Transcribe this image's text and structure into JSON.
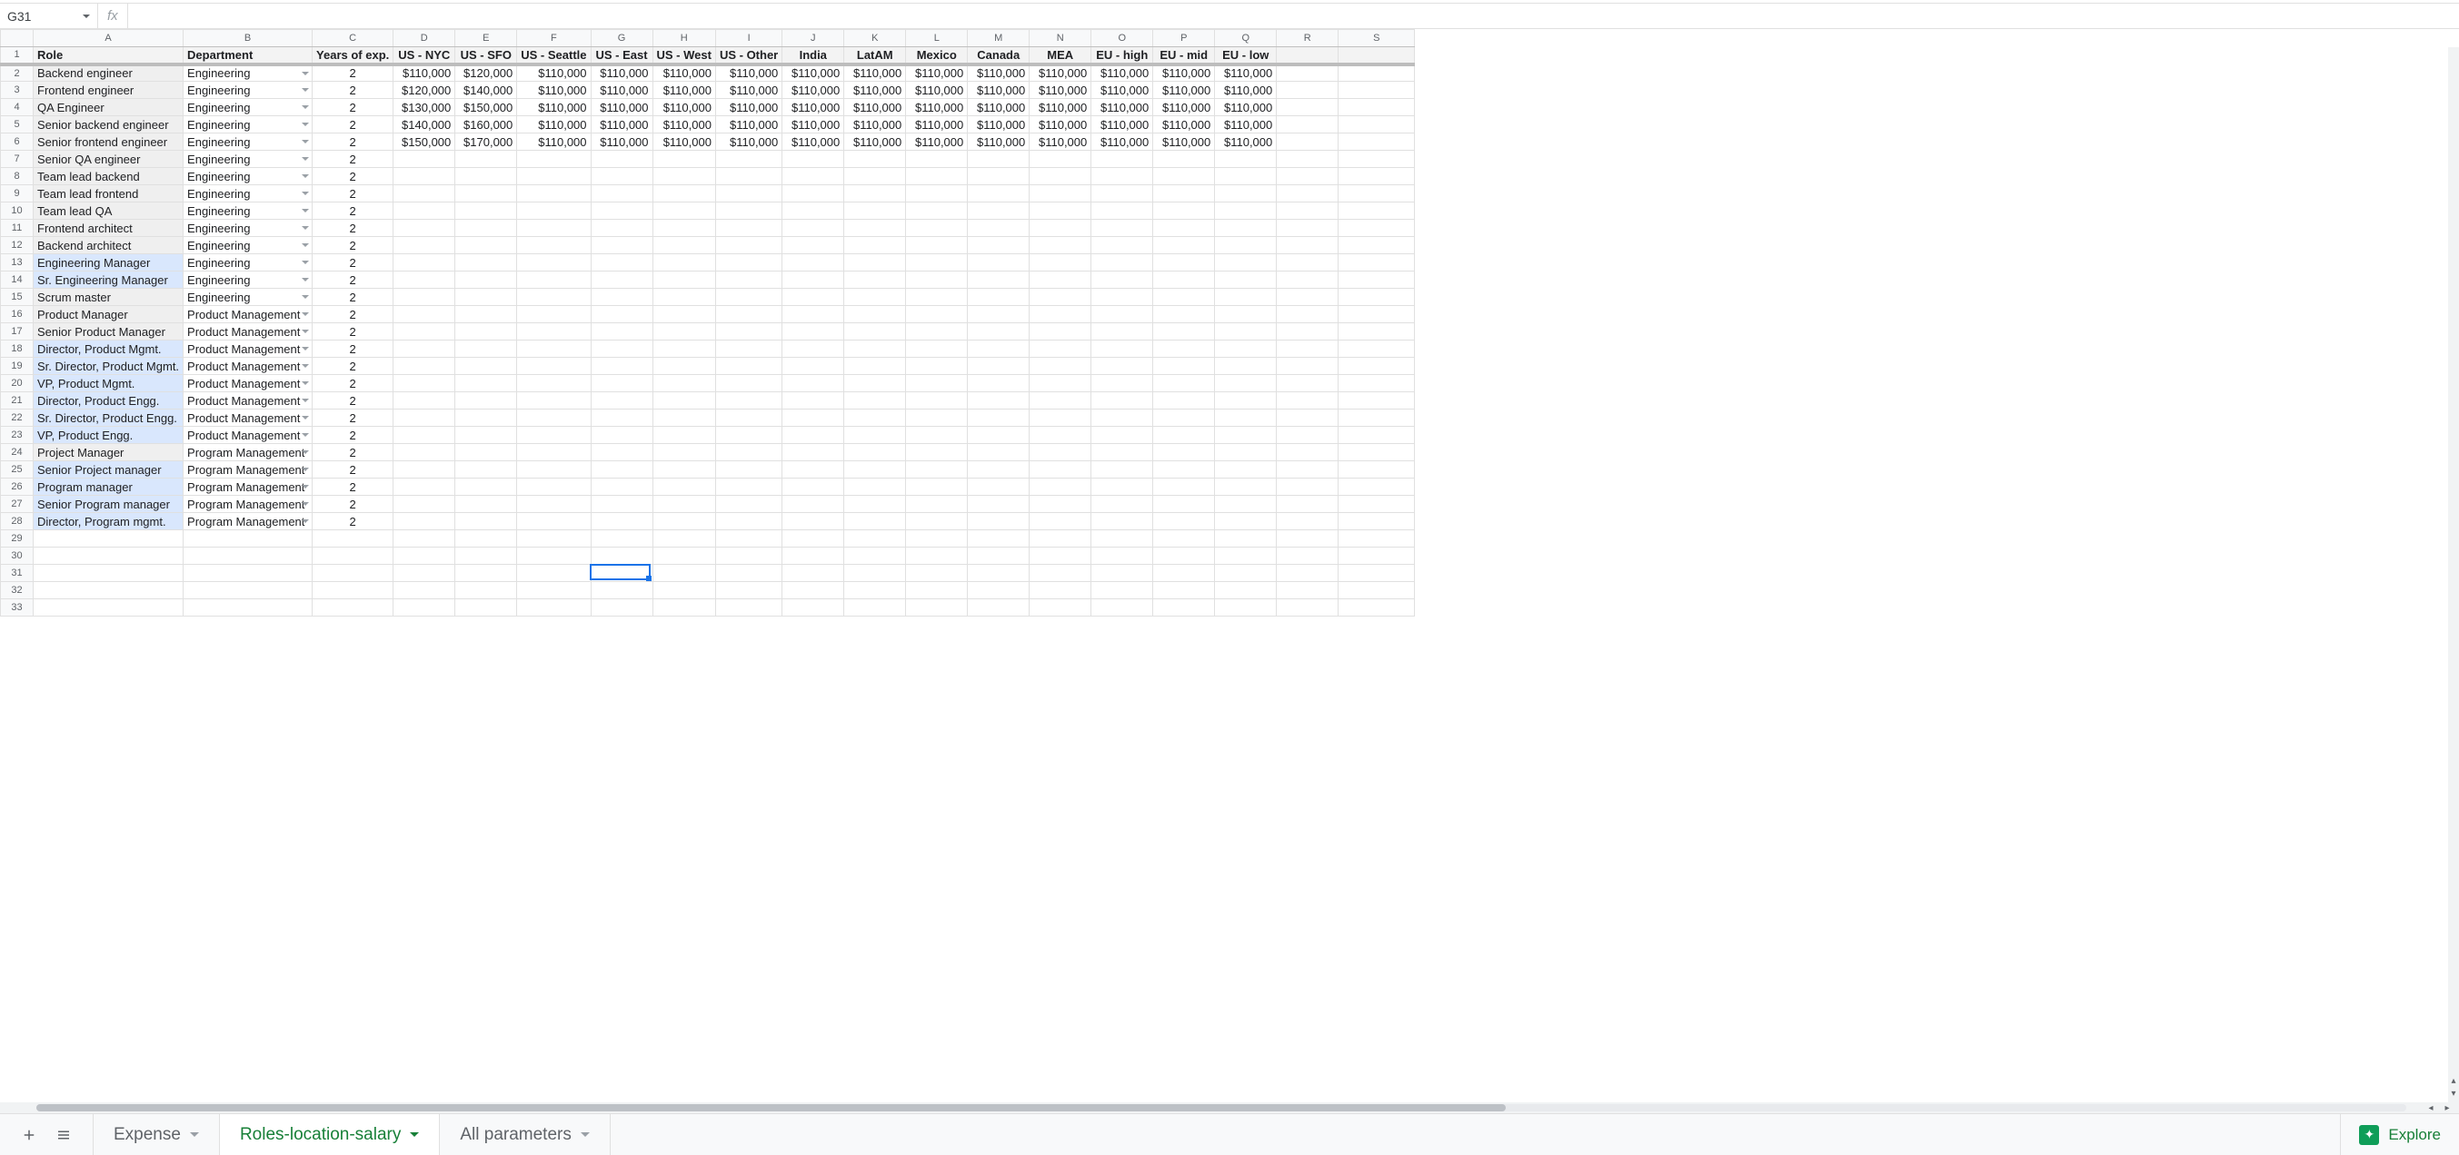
{
  "name_box": "G31",
  "fx_label": "fx",
  "formula_value": "",
  "columns": [
    {
      "letter": "A",
      "width": 160
    },
    {
      "letter": "B",
      "width": 142
    },
    {
      "letter": "C",
      "width": 78
    },
    {
      "letter": "D",
      "width": 68
    },
    {
      "letter": "E",
      "width": 68
    },
    {
      "letter": "F",
      "width": 68
    },
    {
      "letter": "G",
      "width": 68
    },
    {
      "letter": "H",
      "width": 68
    },
    {
      "letter": "I",
      "width": 68
    },
    {
      "letter": "J",
      "width": 68
    },
    {
      "letter": "K",
      "width": 68
    },
    {
      "letter": "L",
      "width": 68
    },
    {
      "letter": "M",
      "width": 68
    },
    {
      "letter": "N",
      "width": 68
    },
    {
      "letter": "O",
      "width": 68
    },
    {
      "letter": "P",
      "width": 68
    },
    {
      "letter": "Q",
      "width": 68
    },
    {
      "letter": "R",
      "width": 68
    },
    {
      "letter": "S",
      "width": 84
    }
  ],
  "header_row": [
    "Role",
    "Department",
    "Years of exp.",
    "US - NYC",
    "US - SFO",
    "US - Seattle",
    "US - East",
    "US - West",
    "US - Other",
    "India",
    "LatAM",
    "Mexico",
    "Canada",
    "MEA",
    "EU - high",
    "EU - mid",
    "EU - low",
    "",
    ""
  ],
  "rows": [
    {
      "n": 2,
      "role": "Backend engineer",
      "mgr": false,
      "dept": "Engineering",
      "yrs": "2",
      "sal": [
        "$110,000",
        "$120,000",
        "$110,000",
        "$110,000",
        "$110,000",
        "$110,000",
        "$110,000",
        "$110,000",
        "$110,000",
        "$110,000",
        "$110,000",
        "$110,000",
        "$110,000",
        "$110,000"
      ]
    },
    {
      "n": 3,
      "role": "Frontend engineer",
      "mgr": false,
      "dept": "Engineering",
      "yrs": "2",
      "sal": [
        "$120,000",
        "$140,000",
        "$110,000",
        "$110,000",
        "$110,000",
        "$110,000",
        "$110,000",
        "$110,000",
        "$110,000",
        "$110,000",
        "$110,000",
        "$110,000",
        "$110,000",
        "$110,000"
      ]
    },
    {
      "n": 4,
      "role": "QA Engineer",
      "mgr": false,
      "dept": "Engineering",
      "yrs": "2",
      "sal": [
        "$130,000",
        "$150,000",
        "$110,000",
        "$110,000",
        "$110,000",
        "$110,000",
        "$110,000",
        "$110,000",
        "$110,000",
        "$110,000",
        "$110,000",
        "$110,000",
        "$110,000",
        "$110,000"
      ]
    },
    {
      "n": 5,
      "role": "Senior backend engineer",
      "mgr": false,
      "dept": "Engineering",
      "yrs": "2",
      "sal": [
        "$140,000",
        "$160,000",
        "$110,000",
        "$110,000",
        "$110,000",
        "$110,000",
        "$110,000",
        "$110,000",
        "$110,000",
        "$110,000",
        "$110,000",
        "$110,000",
        "$110,000",
        "$110,000"
      ]
    },
    {
      "n": 6,
      "role": "Senior frontend engineer",
      "mgr": false,
      "dept": "Engineering",
      "yrs": "2",
      "sal": [
        "$150,000",
        "$170,000",
        "$110,000",
        "$110,000",
        "$110,000",
        "$110,000",
        "$110,000",
        "$110,000",
        "$110,000",
        "$110,000",
        "$110,000",
        "$110,000",
        "$110,000",
        "$110,000"
      ]
    },
    {
      "n": 7,
      "role": "Senior QA engineer",
      "mgr": false,
      "dept": "Engineering",
      "yrs": "2",
      "sal": []
    },
    {
      "n": 8,
      "role": "Team lead backend",
      "mgr": false,
      "dept": "Engineering",
      "yrs": "2",
      "sal": []
    },
    {
      "n": 9,
      "role": "Team lead frontend",
      "mgr": false,
      "dept": "Engineering",
      "yrs": "2",
      "sal": []
    },
    {
      "n": 10,
      "role": "Team lead QA",
      "mgr": false,
      "dept": "Engineering",
      "yrs": "2",
      "sal": []
    },
    {
      "n": 11,
      "role": "Frontend architect",
      "mgr": false,
      "dept": "Engineering",
      "yrs": "2",
      "sal": []
    },
    {
      "n": 12,
      "role": "Backend architect",
      "mgr": false,
      "dept": "Engineering",
      "yrs": "2",
      "sal": []
    },
    {
      "n": 13,
      "role": "Engineering Manager",
      "mgr": true,
      "dept": "Engineering",
      "yrs": "2",
      "sal": []
    },
    {
      "n": 14,
      "role": "Sr. Engineering Manager",
      "mgr": true,
      "dept": "Engineering",
      "yrs": "2",
      "sal": []
    },
    {
      "n": 15,
      "role": "Scrum master",
      "mgr": false,
      "dept": "Engineering",
      "yrs": "2",
      "sal": []
    },
    {
      "n": 16,
      "role": "Product Manager",
      "mgr": false,
      "dept": "Product Management",
      "yrs": "2",
      "sal": []
    },
    {
      "n": 17,
      "role": "Senior Product Manager",
      "mgr": false,
      "dept": "Product Management",
      "yrs": "2",
      "sal": []
    },
    {
      "n": 18,
      "role": "Director, Product Mgmt.",
      "mgr": true,
      "dept": "Product Management",
      "yrs": "2",
      "sal": []
    },
    {
      "n": 19,
      "role": "Sr. Director, Product Mgmt.",
      "mgr": true,
      "dept": "Product Management",
      "yrs": "2",
      "sal": []
    },
    {
      "n": 20,
      "role": "VP, Product Mgmt.",
      "mgr": true,
      "dept": "Product Management",
      "yrs": "2",
      "sal": []
    },
    {
      "n": 21,
      "role": "Director, Product Engg.",
      "mgr": true,
      "dept": "Product Management",
      "yrs": "2",
      "sal": []
    },
    {
      "n": 22,
      "role": "Sr. Director, Product Engg.",
      "mgr": true,
      "dept": "Product Management",
      "yrs": "2",
      "sal": []
    },
    {
      "n": 23,
      "role": "VP, Product Engg.",
      "mgr": true,
      "dept": "Product Management",
      "yrs": "2",
      "sal": []
    },
    {
      "n": 24,
      "role": "Project Manager",
      "mgr": false,
      "dept": "Program Management",
      "yrs": "2",
      "sal": []
    },
    {
      "n": 25,
      "role": "Senior Project manager",
      "mgr": true,
      "dept": "Program Management",
      "yrs": "2",
      "sal": []
    },
    {
      "n": 26,
      "role": "Program manager",
      "mgr": true,
      "dept": "Program Management",
      "yrs": "2",
      "sal": []
    },
    {
      "n": 27,
      "role": "Senior Program manager",
      "mgr": true,
      "dept": "Program Management",
      "yrs": "2",
      "sal": []
    },
    {
      "n": 28,
      "role": "Director, Program mgmt.",
      "mgr": true,
      "dept": "Program Management",
      "yrs": "2",
      "sal": []
    }
  ],
  "empty_rows": [
    29,
    30,
    31,
    32,
    33
  ],
  "active_cell": {
    "row": 31,
    "col": "G"
  },
  "tabs": [
    {
      "label": "Expense",
      "active": false
    },
    {
      "label": "Roles-location-salary",
      "active": true
    },
    {
      "label": "All parameters",
      "active": false
    }
  ],
  "explore_label": "Explore"
}
